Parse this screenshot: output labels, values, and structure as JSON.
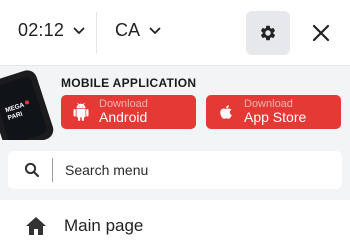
{
  "header": {
    "time": "02:12",
    "region": "CA",
    "icons": {
      "settings": "gear-icon",
      "close": "close-icon",
      "time_dropdown": "chevron-down-icon",
      "region_dropdown": "chevron-down-icon"
    }
  },
  "promo": {
    "title": "MOBILE APPLICATION",
    "brand_logo_text": "MEGA PARI",
    "android": {
      "small": "Download",
      "big": "Android",
      "icon": "android-icon"
    },
    "apple": {
      "small": "Download",
      "big": "App Store",
      "icon": "apple-icon"
    }
  },
  "search": {
    "placeholder": "Search menu",
    "icon": "search-icon"
  },
  "menu": {
    "items": [
      {
        "label": "Main page",
        "icon": "home-icon"
      }
    ]
  },
  "colors": {
    "accent": "#e53935",
    "panel_bg": "#f2f4f6",
    "settings_bg": "#e6e8eb"
  }
}
